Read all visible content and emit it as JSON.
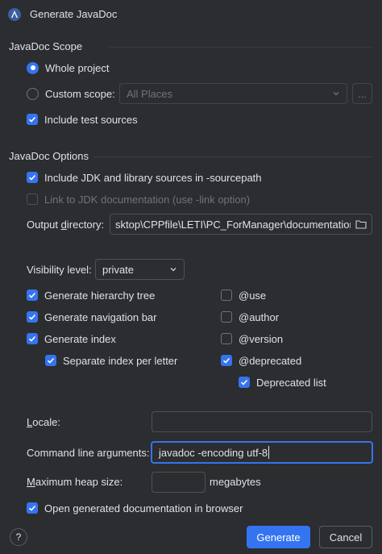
{
  "window": {
    "title": "Generate JavaDoc"
  },
  "scope": {
    "section_title": "JavaDoc Scope",
    "whole_project_label": "Whole project",
    "whole_project_selected": true,
    "custom_scope_label": "Custom scope:",
    "custom_scope_value": "All Places",
    "custom_scope_browse": "...",
    "include_test_sources_label": "Include test sources",
    "include_test_sources_checked": true
  },
  "options": {
    "section_title": "JavaDoc Options",
    "include_jdk_label": "Include JDK and library sources in -sourcepath",
    "include_jdk_checked": true,
    "link_jdk_label": "Link to JDK documentation (use -link option)",
    "link_jdk_checked": false,
    "output_dir_label": "Output directory:",
    "output_dir_value": "sktop\\CPPfile\\LETI\\PC_ForManager\\documentation",
    "visibility_label": "Visibility level:",
    "visibility_value": "private",
    "left_checks": [
      {
        "label": "Generate hierarchy tree",
        "checked": true
      },
      {
        "label": "Generate navigation bar",
        "checked": true
      },
      {
        "label": "Generate index",
        "checked": true
      },
      {
        "label": "Separate index per letter",
        "checked": true
      }
    ],
    "right_checks": [
      {
        "label": "@use",
        "checked": false
      },
      {
        "label": "@author",
        "checked": false
      },
      {
        "label": "@version",
        "checked": false
      },
      {
        "label": "@deprecated",
        "checked": true
      },
      {
        "label": "Deprecated list",
        "checked": true
      }
    ],
    "locale_label": "Locale:",
    "locale_value": "",
    "cmd_args_label": "Command line arguments:",
    "cmd_args_value": "javadoc -encoding utf-8",
    "heap_label": "Maximum heap size:",
    "heap_value": "",
    "heap_unit": "megabytes",
    "open_browser_label": "Open generated documentation in browser",
    "open_browser_checked": true
  },
  "footer": {
    "help": "?",
    "generate_label": "Generate",
    "cancel_label": "Cancel"
  },
  "colors": {
    "background": "#2b2d30",
    "accent": "#3574f0",
    "text": "#dfe1e5",
    "disabled_text": "#6f737a"
  }
}
